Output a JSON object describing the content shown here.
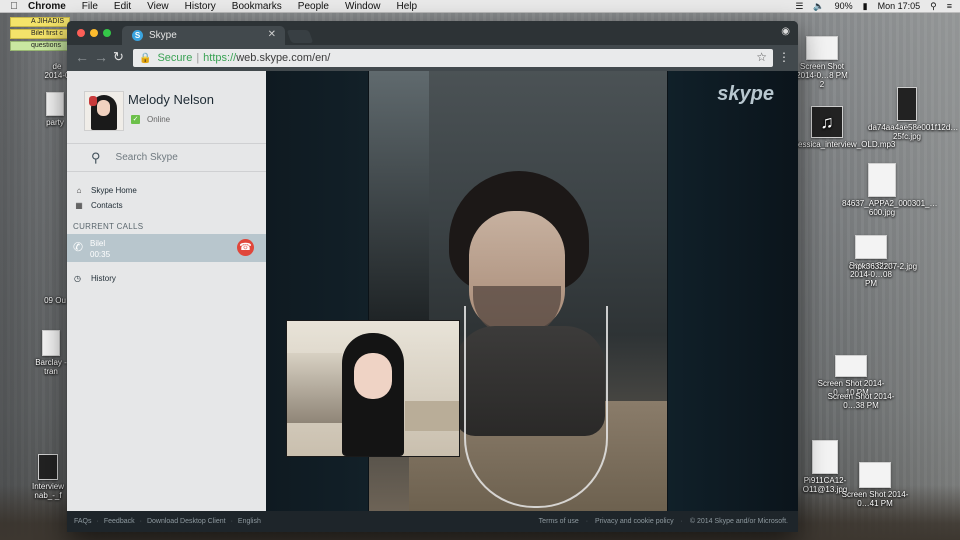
{
  "menubar": {
    "app": "Chrome",
    "items": [
      "File",
      "Edit",
      "View",
      "History",
      "Bookmarks",
      "People",
      "Window",
      "Help"
    ],
    "battery": "90%",
    "clock": "Mon 17:05"
  },
  "notes": [
    "A JIHADIS",
    "Bilel first c",
    "questions"
  ],
  "desktop_icons": [
    {
      "label": "Screen Shot 2014-0…8 PM 2"
    },
    {
      "label": "da74aa4ae58e001f12d…25fc.jpg"
    },
    {
      "label": "Jessica_interview_OLD.mp3"
    },
    {
      "label": "84637_APPA2_000301_…600.jpg"
    },
    {
      "label": "chpk3632207-2.jpg"
    },
    {
      "label": "Screen Shot 2014-0…08 PM"
    },
    {
      "label": "Screen Shot 2014-0…10 PM"
    },
    {
      "label": "Screen Shot 2014-0…38 PM"
    },
    {
      "label": "Pi911CA12-O11@13.jpg"
    },
    {
      "label": "Screen Shot 2014-0…41 PM"
    },
    {
      "label": "Interview nab_-_f"
    },
    {
      "label": "Barclay - tran"
    },
    {
      "label": "09 Ou"
    },
    {
      "label": "party"
    },
    {
      "label": "de 2014-0"
    }
  ],
  "browser": {
    "tab_title": "Skype",
    "secure_label": "Secure",
    "url_scheme": "https://",
    "url_host": "web.skype.com/en/"
  },
  "skype": {
    "user_name": "Melody Nelson",
    "status": "Online",
    "search_placeholder": "Search Skype",
    "nav": [
      "Skype Home",
      "Contacts"
    ],
    "current_calls_header": "CURRENT CALLS",
    "call": {
      "name": "Bilel",
      "duration": "00:35"
    },
    "history": "History",
    "logo": "skype"
  },
  "footer": {
    "left": [
      "FAQs",
      "Feedback",
      "Download Desktop Client",
      "English"
    ],
    "right": [
      "Terms of use",
      "Privacy and cookie policy",
      "© 2014 Skype and/or Microsoft."
    ]
  }
}
